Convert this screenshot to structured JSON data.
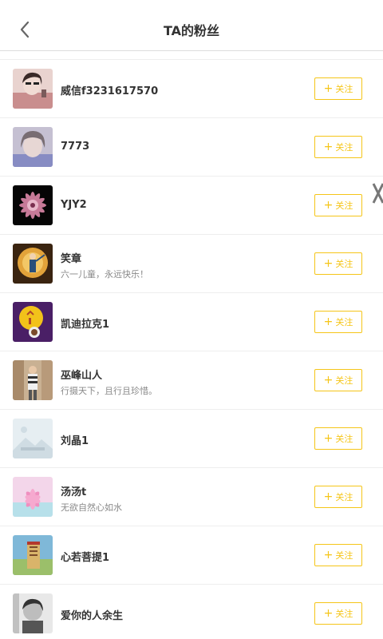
{
  "header": {
    "title": "TA的粉丝",
    "back_icon": "chevron-left-icon"
  },
  "theme": {
    "accent": "#f5c518",
    "text_primary": "#333333",
    "text_secondary": "#888888",
    "divider": "#eeeeee"
  },
  "follow_label": "关注",
  "follow_icon": "plus-icon",
  "users": [
    {
      "name": "威信f3231617570",
      "signature": ""
    },
    {
      "name": "7773",
      "signature": ""
    },
    {
      "name": "YJY2",
      "signature": ""
    },
    {
      "name": "笑章",
      "signature": "六一儿童，永远快乐！"
    },
    {
      "name": "凯迪拉克1",
      "signature": ""
    },
    {
      "name": "巫峰山人",
      "signature": "行摄天下，且行且珍惜。"
    },
    {
      "name": "刘晶1",
      "signature": ""
    },
    {
      "name": "汤汤t",
      "signature": "无欲自然心如水"
    },
    {
      "name": "心若菩提1",
      "signature": ""
    },
    {
      "name": "爱你的人余生",
      "signature": ""
    }
  ]
}
